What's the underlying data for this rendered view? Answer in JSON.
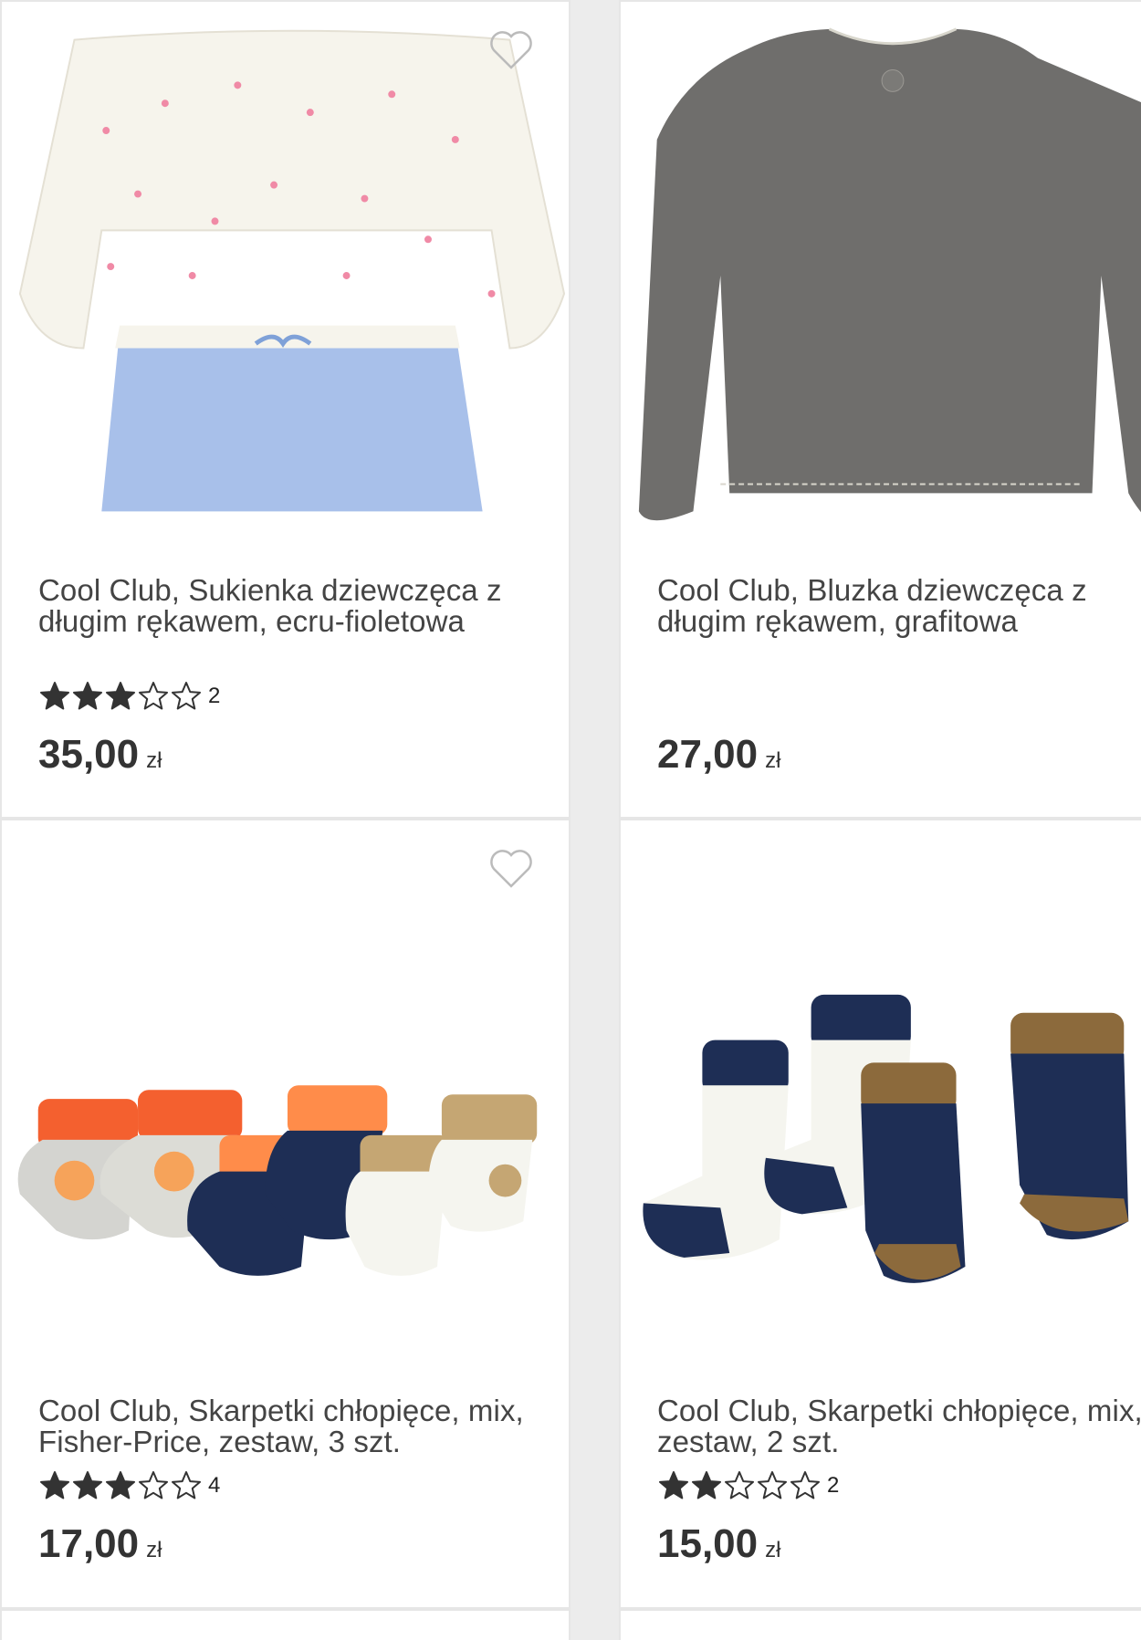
{
  "products": [
    {
      "title": "Cool Club, Sukienka dziewczęca z długim rękawem, ecru-fioletowa",
      "price": "35,00",
      "currency": "zł",
      "rating": 3,
      "rating_count": "2",
      "image_icon": "dress-image"
    },
    {
      "title": "Cool Club, Bluzka dziewczęca z długim rękawem, grafitowa",
      "price": "27,00",
      "currency": "zł",
      "rating": null,
      "rating_count": "",
      "image_icon": "sweatshirt-image"
    },
    {
      "title": "Cool Club, Skarpetki chłopięce, mix, Fisher-Price, zestaw, 3 szt.",
      "price": "17,00",
      "currency": "zł",
      "rating": 3,
      "rating_count": "4",
      "image_icon": "baby-socks-image"
    },
    {
      "title": "Cool Club, Skarpetki chłopięce, mix, zestaw, 2 szt.",
      "price": "15,00",
      "currency": "zł",
      "rating": 2,
      "rating_count": "2",
      "image_icon": "tractor-socks-image"
    }
  ],
  "colors": {
    "star": "#333333",
    "heart": "#bbbbbb",
    "border": "#e6e6e6"
  }
}
